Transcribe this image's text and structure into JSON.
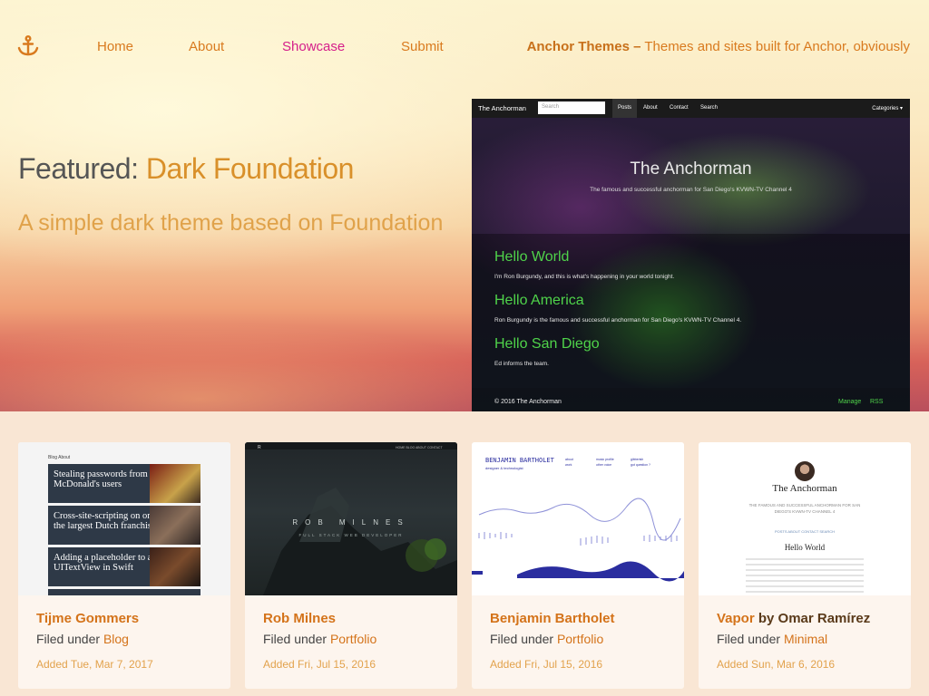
{
  "nav": {
    "logo_icon": "anchor-icon",
    "links": [
      "Home",
      "About",
      "Showcase",
      "Submit"
    ],
    "active": "Showcase",
    "site_name": "Anchor Themes",
    "site_dash": "–",
    "site_tagline": "Themes and sites built for Anchor, obviously"
  },
  "featured": {
    "prefix": "Featured:",
    "name": "Dark Foundation",
    "description": "A simple dark theme based on Foundation",
    "preview": {
      "brand": "The Anchorman",
      "search_placeholder": "Search",
      "nav": [
        "Posts",
        "About",
        "Contact",
        "Search"
      ],
      "categories": "Categories ▾",
      "hero_title": "The Anchorman",
      "hero_sub": "The famous and successful anchorman for San Diego's KVWN-TV Channel 4",
      "posts": [
        {
          "title": "Hello World",
          "text": "I'm Ron Burgundy, and this is what's happening in your world tonight."
        },
        {
          "title": "Hello America",
          "text": "Ron Burgundy is the famous and successful anchorman for San Diego's KVWN-TV Channel 4."
        },
        {
          "title": "Hello San Diego",
          "text": "Ed informs the team."
        }
      ],
      "footer_copy": "© 2016 The Anchorman",
      "footer_links": [
        "Manage",
        "RSS"
      ]
    }
  },
  "cards": [
    {
      "title": "Tijme Gommers",
      "by": "",
      "filed_label": "Filed under",
      "category": "Blog",
      "date": "Added Tue, Mar 7, 2017",
      "thumb": {
        "nav": "Blog    About",
        "tiles": [
          "Stealing passwords from McDonald's users",
          "Cross-site-scripting on one of the largest Dutch franchisors",
          "Adding a placeholder to a UITextView in Swift"
        ]
      }
    },
    {
      "title": "Rob Milnes",
      "by": "",
      "filed_label": "Filed under",
      "category": "Portfolio",
      "date": "Added Fri, Jul 15, 2016",
      "thumb": {
        "title": "ROB MILNES",
        "sub": "FULL STACK WEB DEVELOPER"
      }
    },
    {
      "title": "Benjamin Bartholet",
      "by": "",
      "filed_label": "Filed under",
      "category": "Portfolio",
      "date": "Added Fri, Jul 15, 2016",
      "thumb": {
        "title": "BENJAMIN BARTHOLET",
        "sub": "designer & technologist"
      }
    },
    {
      "title": "Vapor",
      "by": "by Omar Ramírez",
      "filed_label": "Filed under",
      "category": "Minimal",
      "date": "Added Sun, Mar 6, 2016",
      "thumb": {
        "title": "The Anchorman",
        "sub": "THE FAMOUS AND SUCCESSFUL ANCHORMAN FOR SAN DIEGO'S KVWN-TV CHANNEL 4",
        "links": "POSTS   ABOUT   CONTACT   SEARCH",
        "post": "Hello World"
      }
    }
  ]
}
